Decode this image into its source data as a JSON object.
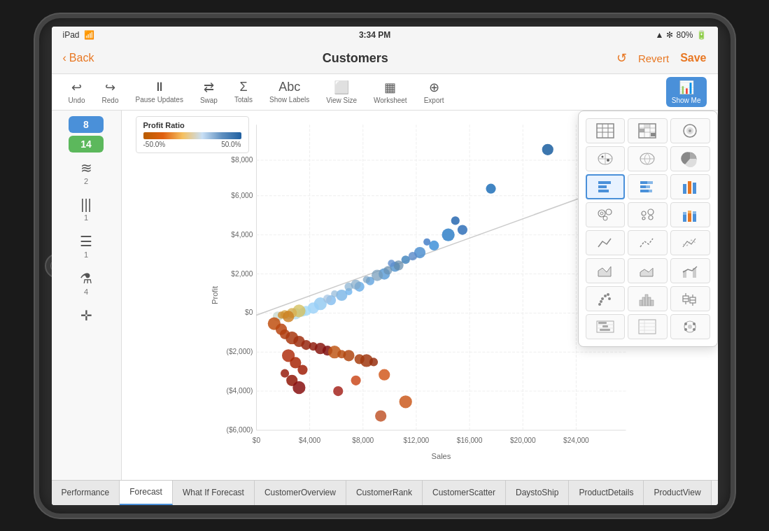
{
  "device": {
    "status_bar": {
      "left": "iPad",
      "center": "3:34 PM",
      "wifi": "wifi",
      "battery": "80%",
      "signal": "▲ *"
    }
  },
  "nav": {
    "back_label": "Back",
    "title": "Customers",
    "revert_label": "Revert",
    "save_label": "Save"
  },
  "toolbar": {
    "undo_label": "Undo",
    "redo_label": "Redo",
    "pause_label": "Pause Updates",
    "swap_label": "Swap",
    "totals_label": "Totals",
    "labels_label": "Show Labels",
    "view_size_label": "View Size",
    "worksheet_label": "Worksheet",
    "export_label": "Export",
    "show_me_label": "Show Me"
  },
  "sidebar": {
    "pill1": "8",
    "pill2": "14",
    "icons": [
      {
        "label": "2",
        "id": "layers"
      },
      {
        "label": "1",
        "id": "bars"
      },
      {
        "label": "1",
        "id": "rows"
      },
      {
        "label": "4",
        "id": "filter"
      },
      {
        "label": "",
        "id": "plus"
      }
    ]
  },
  "chart": {
    "legend_title": "Profit Ratio",
    "legend_min": "-50.0%",
    "legend_max": "50.0%",
    "y_axis_label": "Profit",
    "x_axis_label": "Sales",
    "y_ticks": [
      "$8,000",
      "$6,000",
      "$4,000",
      "$2,000",
      "$0",
      "($2,000)",
      "($4,000)",
      "($6,000)"
    ],
    "x_ticks": [
      "$0",
      "$4,000",
      "$8,000",
      "$12,000",
      "$16,000",
      "$20,000",
      "$24,000"
    ],
    "trend_line": true
  },
  "show_me": {
    "selected_index": 9,
    "items": [
      {
        "id": "text-table",
        "type": "text"
      },
      {
        "id": "highlight-table",
        "type": "highlight"
      },
      {
        "id": "heatmap",
        "type": "heatmap"
      },
      {
        "id": "symbol-map",
        "type": "symbol-map"
      },
      {
        "id": "map",
        "type": "map"
      },
      {
        "id": "pie",
        "type": "pie"
      },
      {
        "id": "h-bars",
        "type": "h-bars"
      },
      {
        "id": "stacked-h-bars",
        "type": "stacked-h-bars"
      },
      {
        "id": "packed-bubbles",
        "type": "packed-bubbles"
      },
      {
        "id": "scatter",
        "type": "scatter"
      },
      {
        "id": "v-bars",
        "type": "v-bars"
      },
      {
        "id": "stacked-v-bars",
        "type": "stacked-v-bars"
      },
      {
        "id": "continuous-line",
        "type": "line"
      },
      {
        "id": "discrete-line",
        "type": "discrete-line"
      },
      {
        "id": "dual-line",
        "type": "dual-line"
      },
      {
        "id": "area",
        "type": "area"
      },
      {
        "id": "discrete-area",
        "type": "discrete-area"
      },
      {
        "id": "dual-combination",
        "type": "dual-combo"
      },
      {
        "id": "scatter-plot",
        "type": "scatter2"
      },
      {
        "id": "histogram",
        "type": "histogram"
      },
      {
        "id": "box-plot",
        "type": "box-plot"
      },
      {
        "id": "gantt",
        "type": "gantt"
      },
      {
        "id": "polygon",
        "type": "polygon"
      },
      {
        "id": "bullet",
        "type": "bullet"
      }
    ]
  },
  "tabs": [
    {
      "label": "Performance",
      "active": false
    },
    {
      "label": "Forecast",
      "active": true
    },
    {
      "label": "What If Forecast",
      "active": false
    },
    {
      "label": "CustomerOverview",
      "active": false
    },
    {
      "label": "CustomerRank",
      "active": false
    },
    {
      "label": "CustomerScatter",
      "active": false
    },
    {
      "label": "DaystoShip",
      "active": false
    },
    {
      "label": "ProductDetails",
      "active": false
    },
    {
      "label": "ProductView",
      "active": false
    }
  ]
}
